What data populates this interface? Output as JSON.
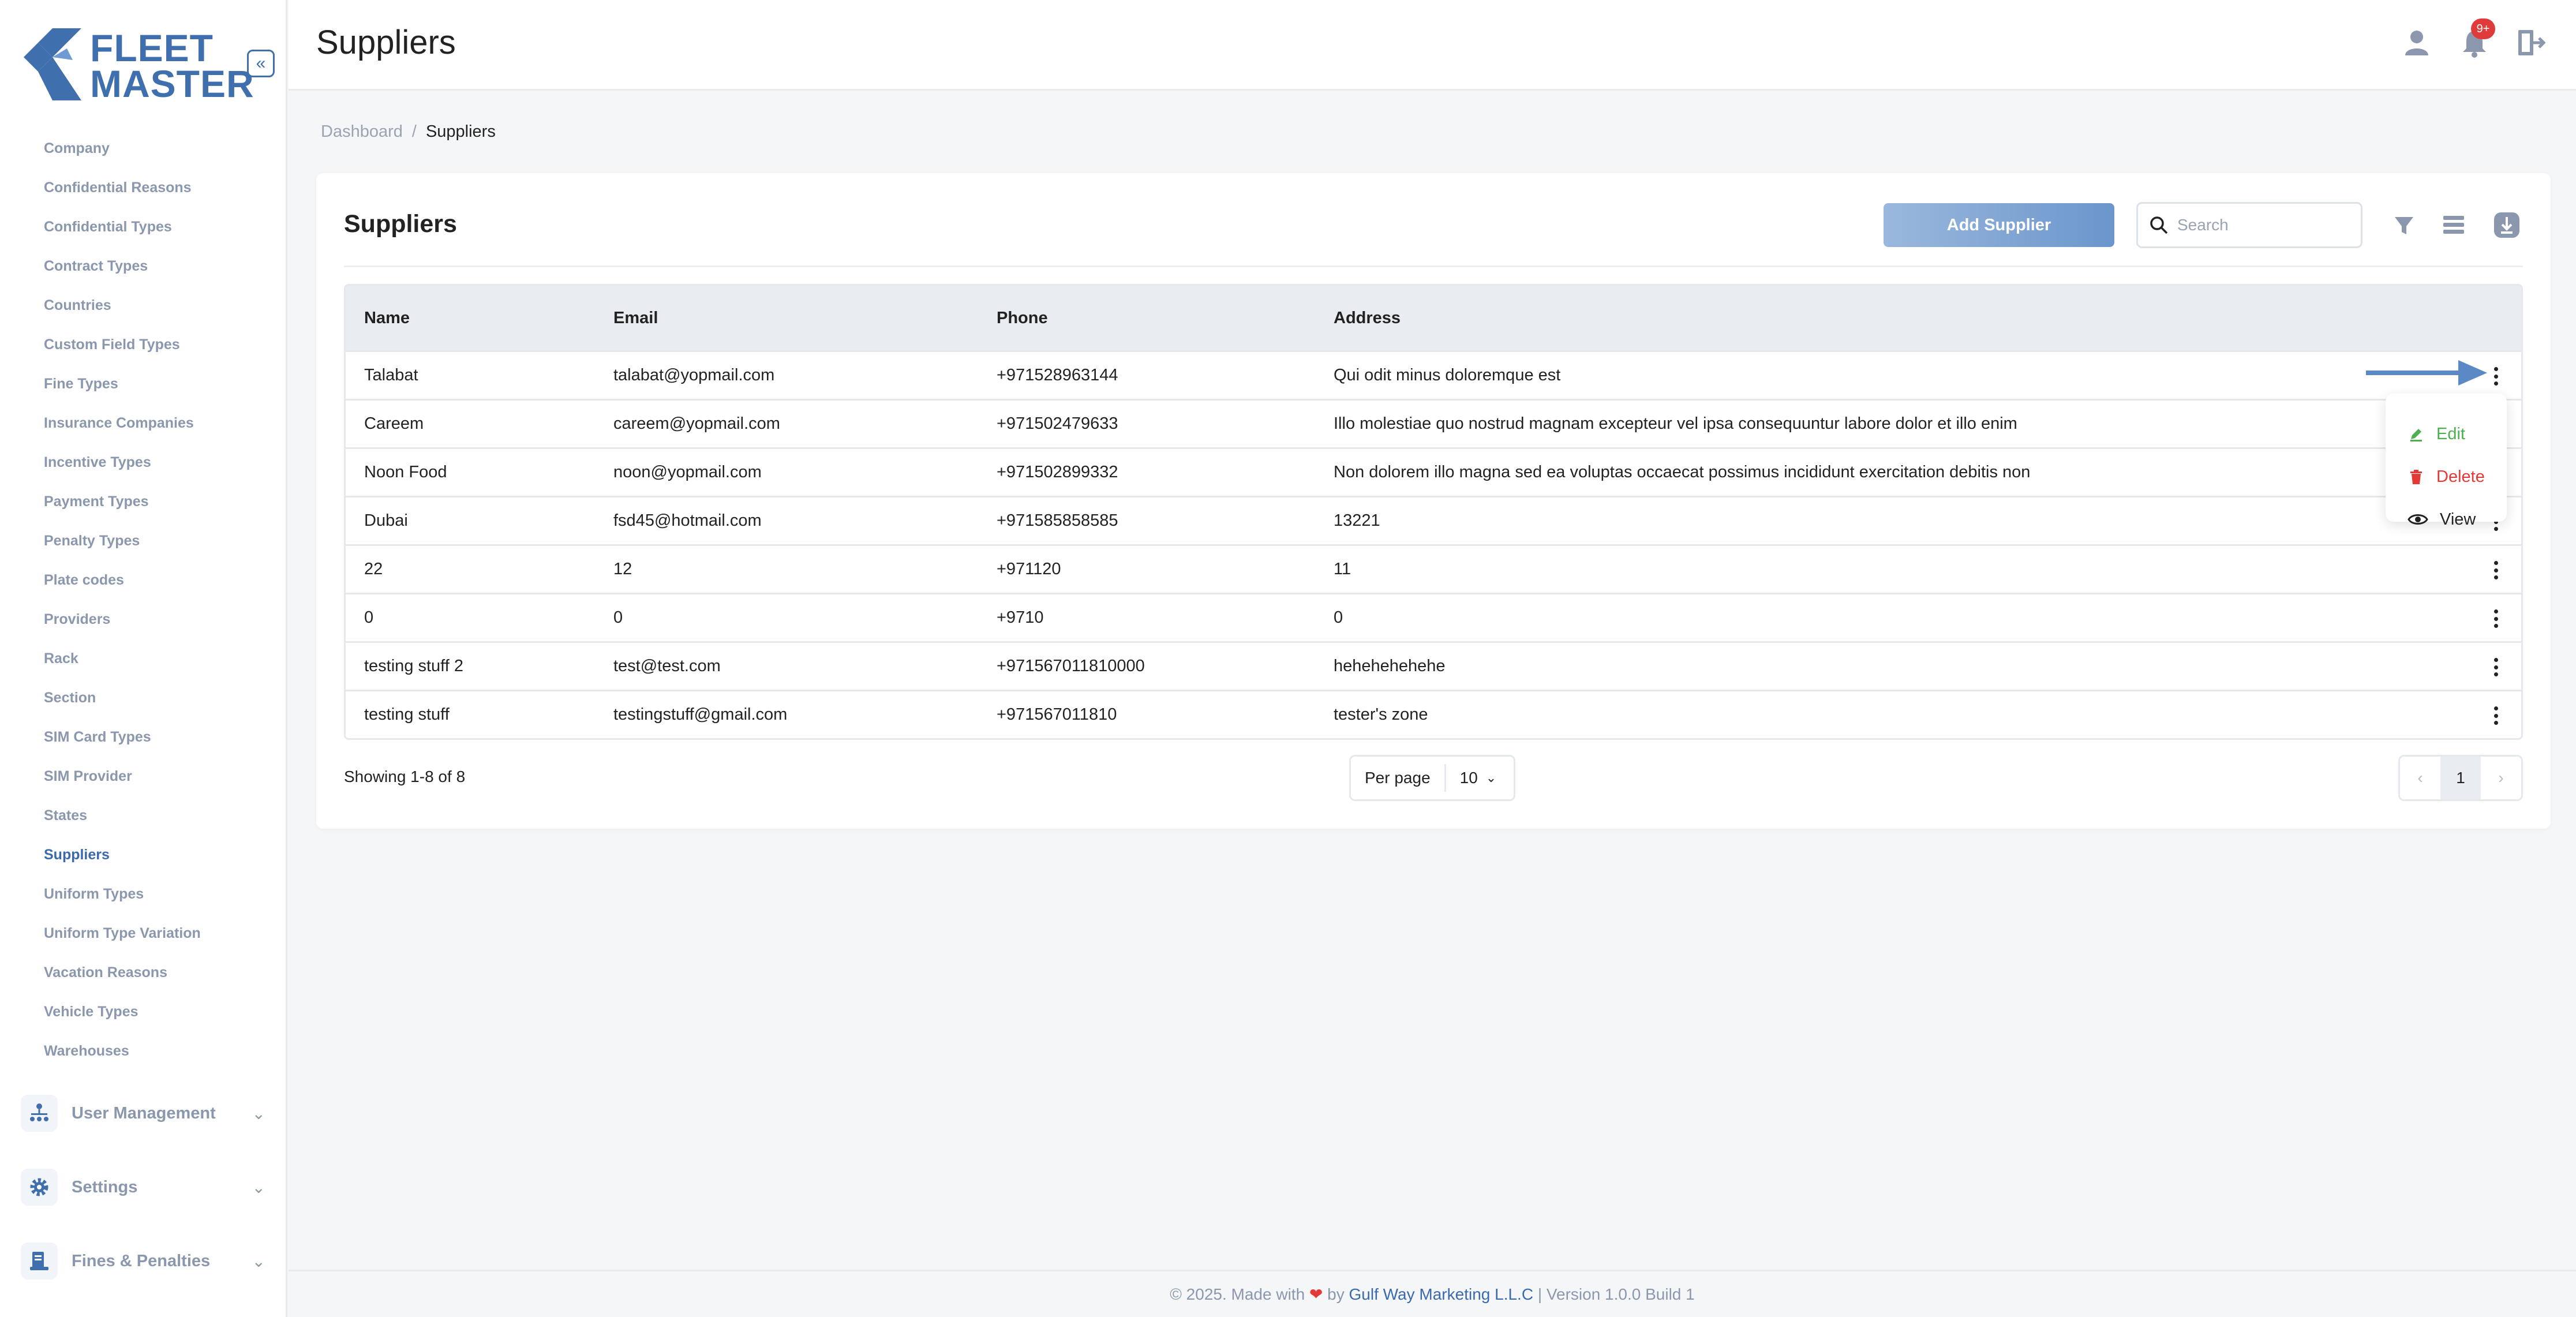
{
  "app": {
    "logo_text_1": "FLEET",
    "logo_text_2": "MASTER"
  },
  "header": {
    "title": "Suppliers",
    "notification_count": "9+"
  },
  "sidebar": {
    "items": [
      {
        "label": "Company"
      },
      {
        "label": "Confidential Reasons"
      },
      {
        "label": "Confidential Types"
      },
      {
        "label": "Contract Types"
      },
      {
        "label": "Countries"
      },
      {
        "label": "Custom Field Types"
      },
      {
        "label": "Fine Types"
      },
      {
        "label": "Insurance Companies"
      },
      {
        "label": "Incentive Types"
      },
      {
        "label": "Payment Types"
      },
      {
        "label": "Penalty Types"
      },
      {
        "label": "Plate codes"
      },
      {
        "label": "Providers"
      },
      {
        "label": "Rack"
      },
      {
        "label": "Section"
      },
      {
        "label": "SIM Card Types"
      },
      {
        "label": "SIM Provider"
      },
      {
        "label": "States"
      },
      {
        "label": "Suppliers",
        "active": true
      },
      {
        "label": "Uniform Types"
      },
      {
        "label": "Uniform Type Variation"
      },
      {
        "label": "Vacation Reasons"
      },
      {
        "label": "Vehicle Types"
      },
      {
        "label": "Warehouses"
      }
    ],
    "groups": [
      {
        "label": "User Management"
      },
      {
        "label": "Settings"
      },
      {
        "label": "Fines & Penalties"
      }
    ]
  },
  "breadcrumb": {
    "root": "Dashboard",
    "separator": "/",
    "current": "Suppliers"
  },
  "card": {
    "title": "Suppliers",
    "add_button": "Add Supplier",
    "search_placeholder": "Search"
  },
  "table": {
    "columns": [
      "Name",
      "Email",
      "Phone",
      "Address"
    ],
    "rows": [
      {
        "name": "Talabat",
        "email": "talabat@yopmail.com",
        "phone": "+971528963144",
        "address": "Qui odit minus doloremque est"
      },
      {
        "name": "Careem",
        "email": "careem@yopmail.com",
        "phone": "+971502479633",
        "address": "Illo molestiae quo nostrud magnam excepteur vel ipsa consequuntur labore dolor et illo enim"
      },
      {
        "name": "Noon Food",
        "email": "noon@yopmail.com",
        "phone": "+971502899332",
        "address": "Non dolorem illo magna sed ea voluptas occaecat possimus incididunt exercitation debitis non"
      },
      {
        "name": "Dubai",
        "email": "fsd45@hotmail.com",
        "phone": "+971585858585",
        "address": "13221"
      },
      {
        "name": "22",
        "email": "12",
        "phone": "+971120",
        "address": "11"
      },
      {
        "name": "0",
        "email": "0",
        "phone": "+9710",
        "address": "0"
      },
      {
        "name": "testing stuff 2",
        "email": "test@test.com",
        "phone": "+971567011810000",
        "address": "hehehehehehe"
      },
      {
        "name": "testing stuff",
        "email": "testingstuff@gmail.com",
        "phone": "+971567011810",
        "address": "tester's zone"
      }
    ]
  },
  "pagination": {
    "showing": "Showing 1-8 of 8",
    "per_page_label": "Per page",
    "per_page_value": "10",
    "current_page": "1",
    "prev_icon": "chevron-left-icon",
    "next_icon": "chevron-right-icon"
  },
  "row_menu": {
    "edit": "Edit",
    "delete": "Delete",
    "view": "View",
    "edit_color": "#4caf50",
    "delete_color": "#e53935",
    "view_color": "#222222"
  },
  "footer": {
    "prefix": "© 2025. Made with",
    "by": "by",
    "company": "Gulf Way Marketing L.L.C",
    "version": "| Version 1.0.0 Build 1"
  },
  "colors": {
    "accent": "#3f6fad",
    "active_nav": "#3a6aad",
    "badge": "#e03b3b"
  }
}
